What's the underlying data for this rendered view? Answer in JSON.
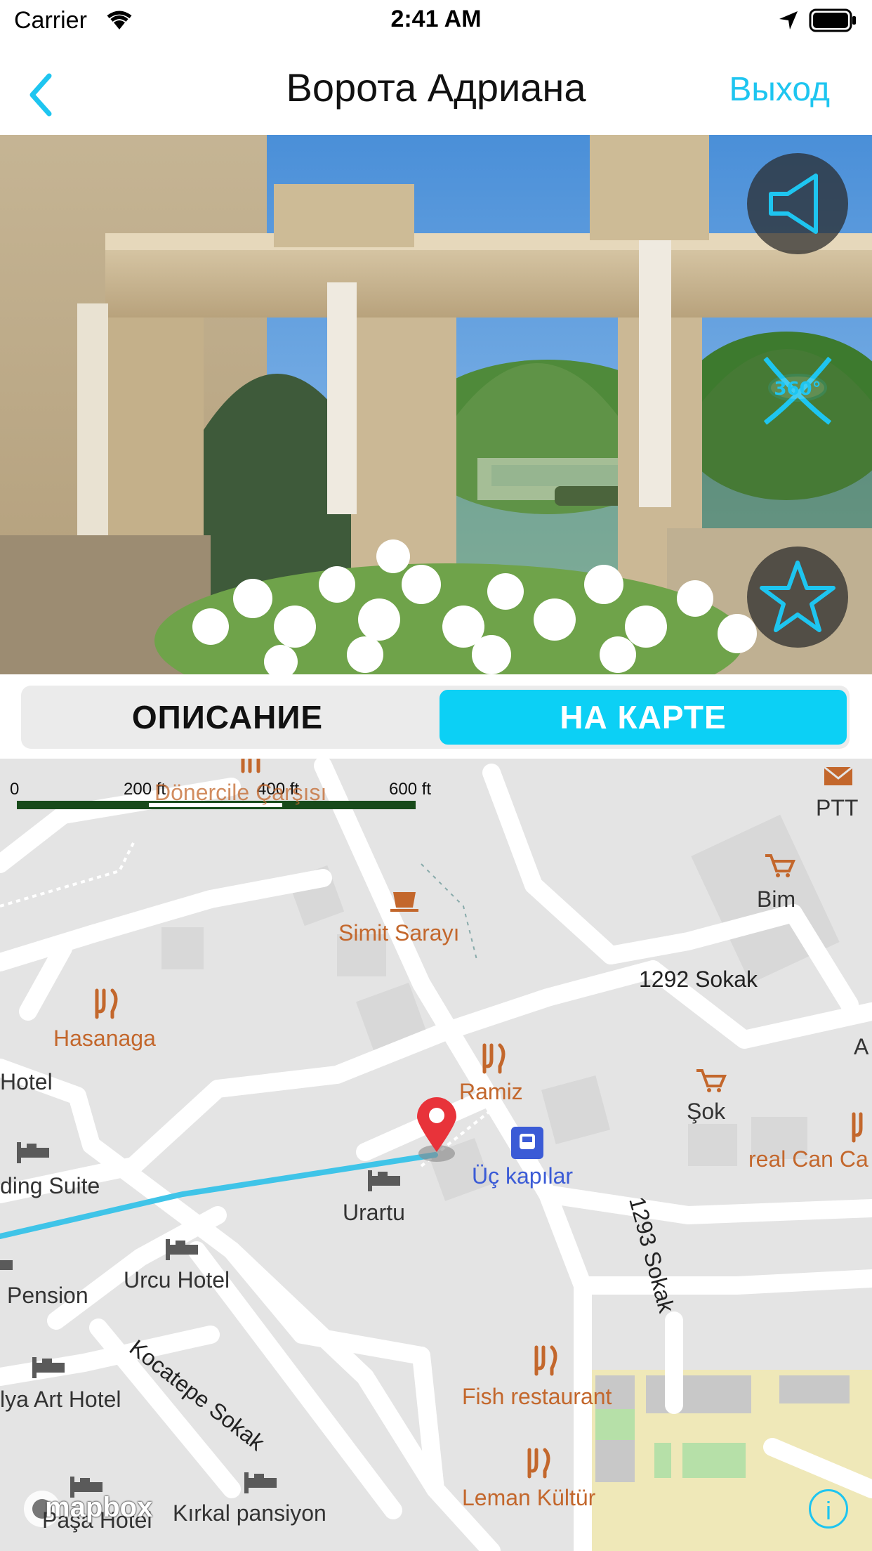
{
  "status_bar": {
    "carrier": "Carrier",
    "time": "2:41 AM"
  },
  "nav": {
    "title": "Ворота Адриана",
    "exit_label": "Выход"
  },
  "hero": {
    "buttons": [
      "speaker-icon",
      "360-view-icon",
      "star-icon"
    ],
    "badge_360": "360°"
  },
  "segments": {
    "description": "ОПИСАНИЕ",
    "on_map": "НА КАРТЕ",
    "selected": "on_map"
  },
  "map": {
    "scale": {
      "labels": [
        "0",
        "200 ft",
        "400 ft",
        "600 ft"
      ]
    },
    "pois": [
      {
        "label": "Dönercile Çarşısı"
      },
      {
        "label": "PTT"
      },
      {
        "label": "Bim"
      },
      {
        "label": "Simit Sarayı"
      },
      {
        "label": "Hasanaga"
      },
      {
        "label": "Hotel"
      },
      {
        "label": "Ramiz"
      },
      {
        "label": "Şok"
      },
      {
        "label": "real Can Ca"
      },
      {
        "label": "Üç kapılar"
      },
      {
        "label": "ding Suite"
      },
      {
        "label": "Urartu"
      },
      {
        "label": "Pension"
      },
      {
        "label": "Urcu Hotel"
      },
      {
        "label": "lya Art Hotel"
      },
      {
        "label": "Fish restaurant"
      },
      {
        "label": "Leman Kültür"
      },
      {
        "label": "Kırkal pansiyon"
      },
      {
        "label": "Paşa Hotel"
      },
      {
        "label": "A"
      }
    ],
    "streets": {
      "s1293": "1293 Sokak",
      "s1292": "1292 Sokak",
      "kocatepe": "Kocatepe Sokak"
    },
    "attribution": "mapbox",
    "colors": {
      "route": "#3fc4e8",
      "pin": "#e8333a",
      "poi": "#c3672c",
      "accent": "#1ec5f0"
    }
  }
}
